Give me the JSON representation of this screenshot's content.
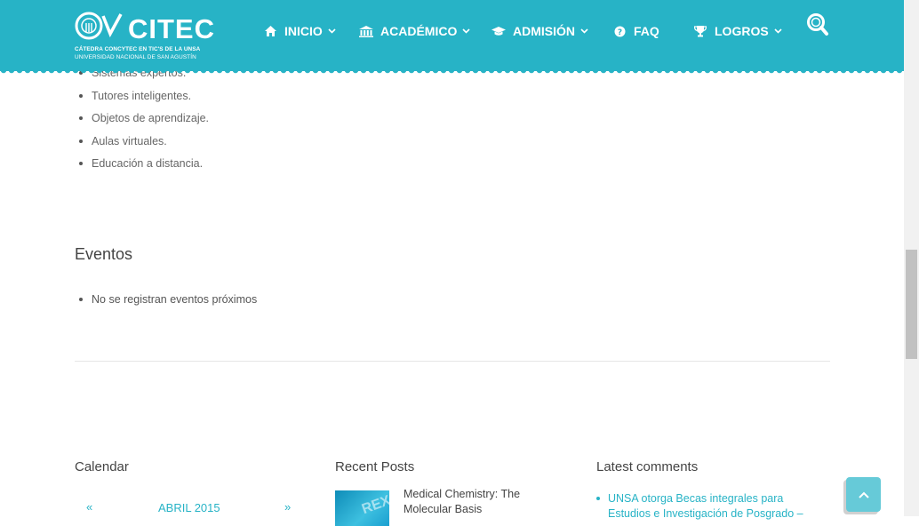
{
  "brand": {
    "name": "CITEC",
    "subtitle_line1": "CÁTEDRA CONCYTEC EN TIC'S DE LA UNSA",
    "subtitle_line2": "UNIVERSIDAD NACIONAL DE SAN AGUSTÍN",
    "colors": {
      "primary": "#27b3c6",
      "text": "#555555"
    }
  },
  "nav": {
    "items": [
      {
        "label": "INICIO",
        "icon": "home-icon",
        "has_dropdown": true
      },
      {
        "label": "ACADÉMICO",
        "icon": "bank-icon",
        "has_dropdown": true
      },
      {
        "label": "ADMISIÓN",
        "icon": "graduation-cap-icon",
        "has_dropdown": true
      },
      {
        "label": "FAQ",
        "icon": "question-circle-icon",
        "has_dropdown": false
      },
      {
        "label": "LOGROS",
        "icon": "trophy-icon",
        "has_dropdown": true
      }
    ],
    "search_icon": "search-icon"
  },
  "topics": [
    "Sistemas expertos.",
    "Tutores inteligentes.",
    "Objetos de aprendizaje.",
    "Aulas virtuales.",
    "Educación a distancia."
  ],
  "events": {
    "title": "Eventos",
    "items": [
      "No se registran eventos próximos"
    ]
  },
  "footer": {
    "calendar": {
      "title": "Calendar",
      "prev": "«",
      "month": "ABRIL 2015",
      "next": "»"
    },
    "recent_posts": {
      "title": "Recent Posts",
      "items": [
        {
          "title": "Medical Chemistry: The Molecular Basis"
        }
      ]
    },
    "latest_comments": {
      "title": "Latest comments",
      "items": [
        {
          "text": "UNSA otorga Becas integrales para Estudios e Investigación de Posgrado –"
        }
      ]
    }
  },
  "back_to_top_icon": "chevron-up-icon"
}
